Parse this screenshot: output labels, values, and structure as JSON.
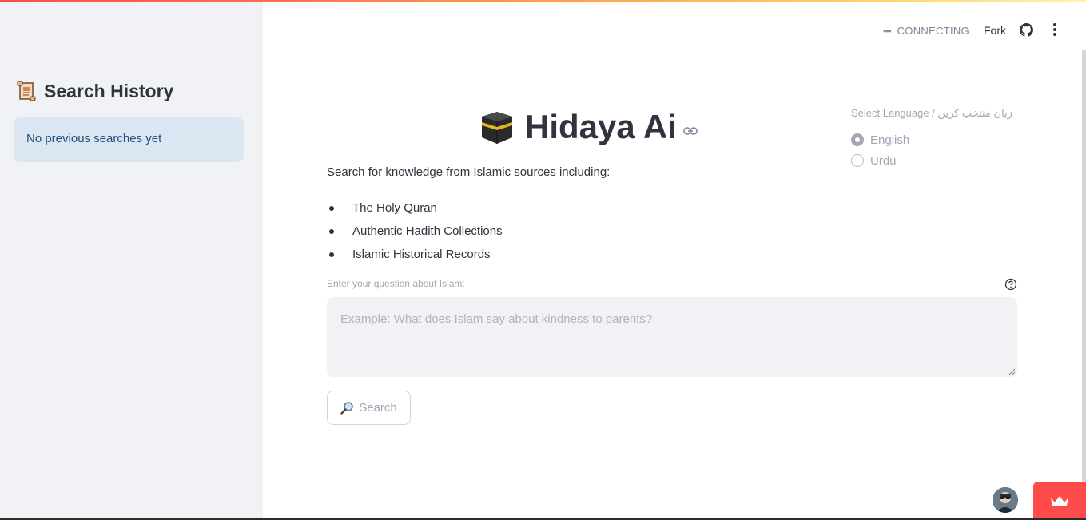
{
  "header": {
    "status": "CONNECTING",
    "fork_label": "Fork"
  },
  "sidebar": {
    "title": "Search History",
    "empty_message": "No previous searches yet"
  },
  "main": {
    "title": "Hidaya Ai",
    "intro": "Search for knowledge from Islamic sources including:",
    "sources": [
      "The Holy Quran",
      "Authentic Hadith Collections",
      "Islamic Historical Records"
    ],
    "question_label": "Enter your question about Islam:",
    "question_placeholder": "Example: What does Islam say about kindness to parents?",
    "question_value": "",
    "search_button_label": "Search"
  },
  "language": {
    "label": "Select Language / زبان منتخب کریں",
    "options": [
      "English",
      "Urdu"
    ],
    "selected": "English"
  },
  "colors": {
    "accent": "#ff4b4b",
    "sidebar_bg": "#f0f2f6",
    "info_bg": "#dce6f3",
    "info_text": "#1f4e7a"
  },
  "icons": [
    "scroll-icon",
    "kaaba-icon",
    "link-icon",
    "github-icon",
    "more-vertical-icon",
    "help-icon",
    "search-icon",
    "crown-icon"
  ]
}
